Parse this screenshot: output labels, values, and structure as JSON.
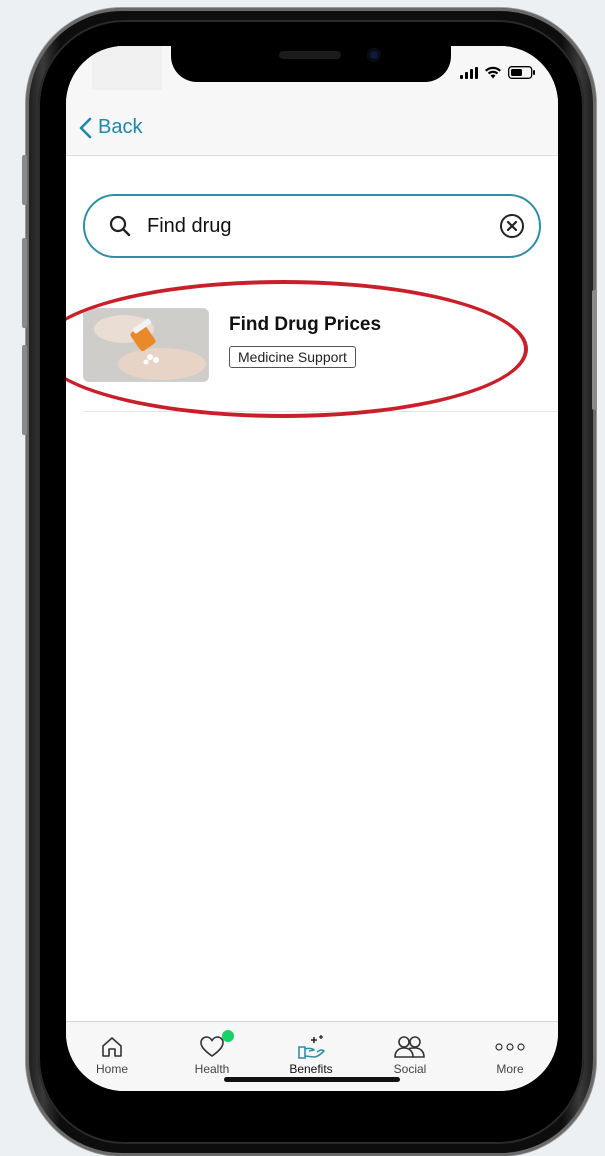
{
  "nav": {
    "back_label": "Back"
  },
  "search": {
    "value": "Find drug",
    "placeholder": ""
  },
  "results": [
    {
      "title": "Find Drug Prices",
      "tag": "Medicine Support"
    }
  ],
  "tabbar": {
    "items": [
      {
        "label": "Home",
        "icon": "home-icon"
      },
      {
        "label": "Health",
        "icon": "heart-icon"
      },
      {
        "label": "Benefits",
        "icon": "benefits-hand-icon"
      },
      {
        "label": "Social",
        "icon": "people-icon"
      },
      {
        "label": "More",
        "icon": "more-dots-icon"
      }
    ],
    "active": "Benefits"
  },
  "colors": {
    "accent": "#2f8fa6",
    "link": "#1e88a8",
    "highlight": "#c8202a",
    "notification": "#18d06a"
  }
}
